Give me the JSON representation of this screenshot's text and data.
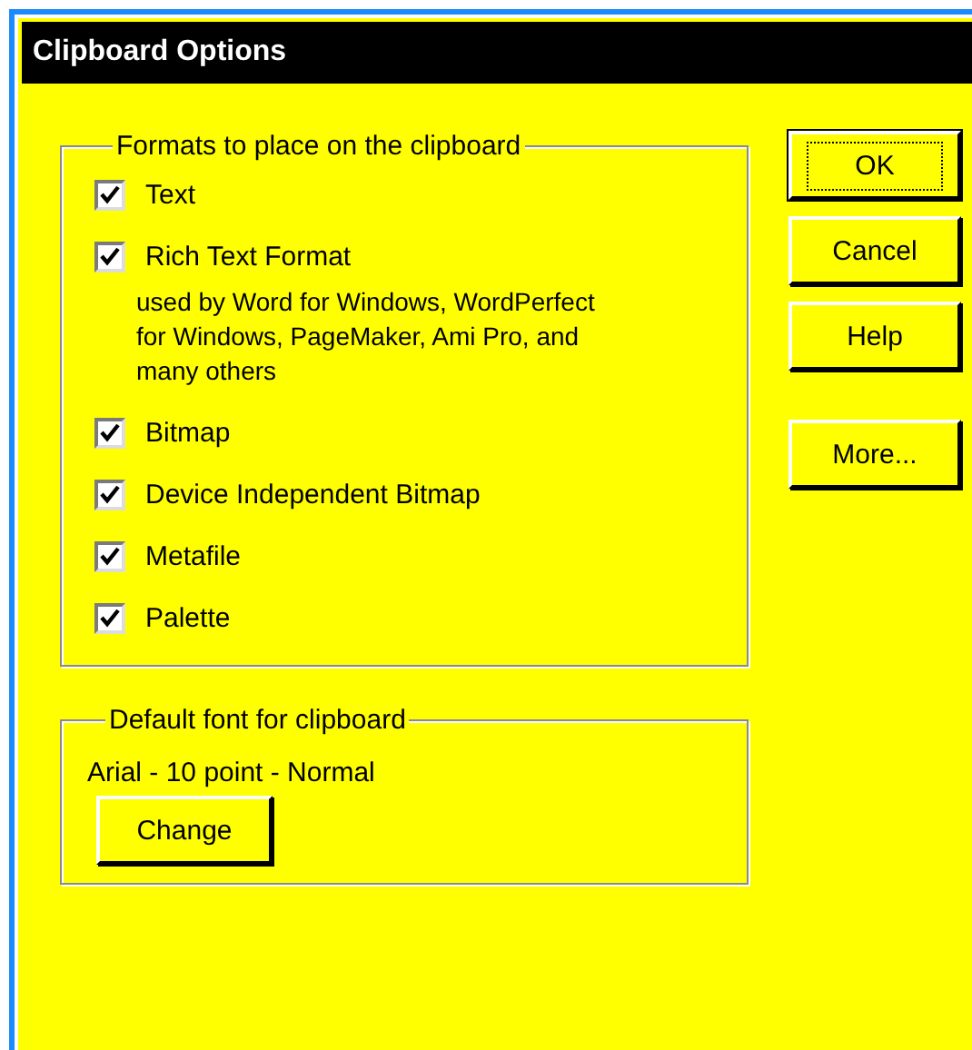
{
  "window": {
    "title": "Clipboard Options"
  },
  "formats": {
    "label": "Formats to place on the clipboard",
    "options": [
      {
        "label": "Text",
        "checked": true
      },
      {
        "label": "Rich Text Format",
        "checked": true,
        "description": "used by Word for Windows, WordPerfect for Windows, PageMaker, Ami Pro, and many others"
      },
      {
        "label": "Bitmap",
        "checked": true
      },
      {
        "label": "Device Independent Bitmap",
        "checked": true
      },
      {
        "label": "Metafile",
        "checked": true
      },
      {
        "label": "Palette",
        "checked": true
      }
    ]
  },
  "font": {
    "label": "Default font for clipboard",
    "value": "Arial - 10 point - Normal",
    "button": "Change"
  },
  "buttons": [
    {
      "label": "OK",
      "default": true
    },
    {
      "label": "Cancel",
      "default": false
    },
    {
      "label": "Help",
      "default": false
    },
    {
      "label": "More...",
      "default": false
    }
  ]
}
